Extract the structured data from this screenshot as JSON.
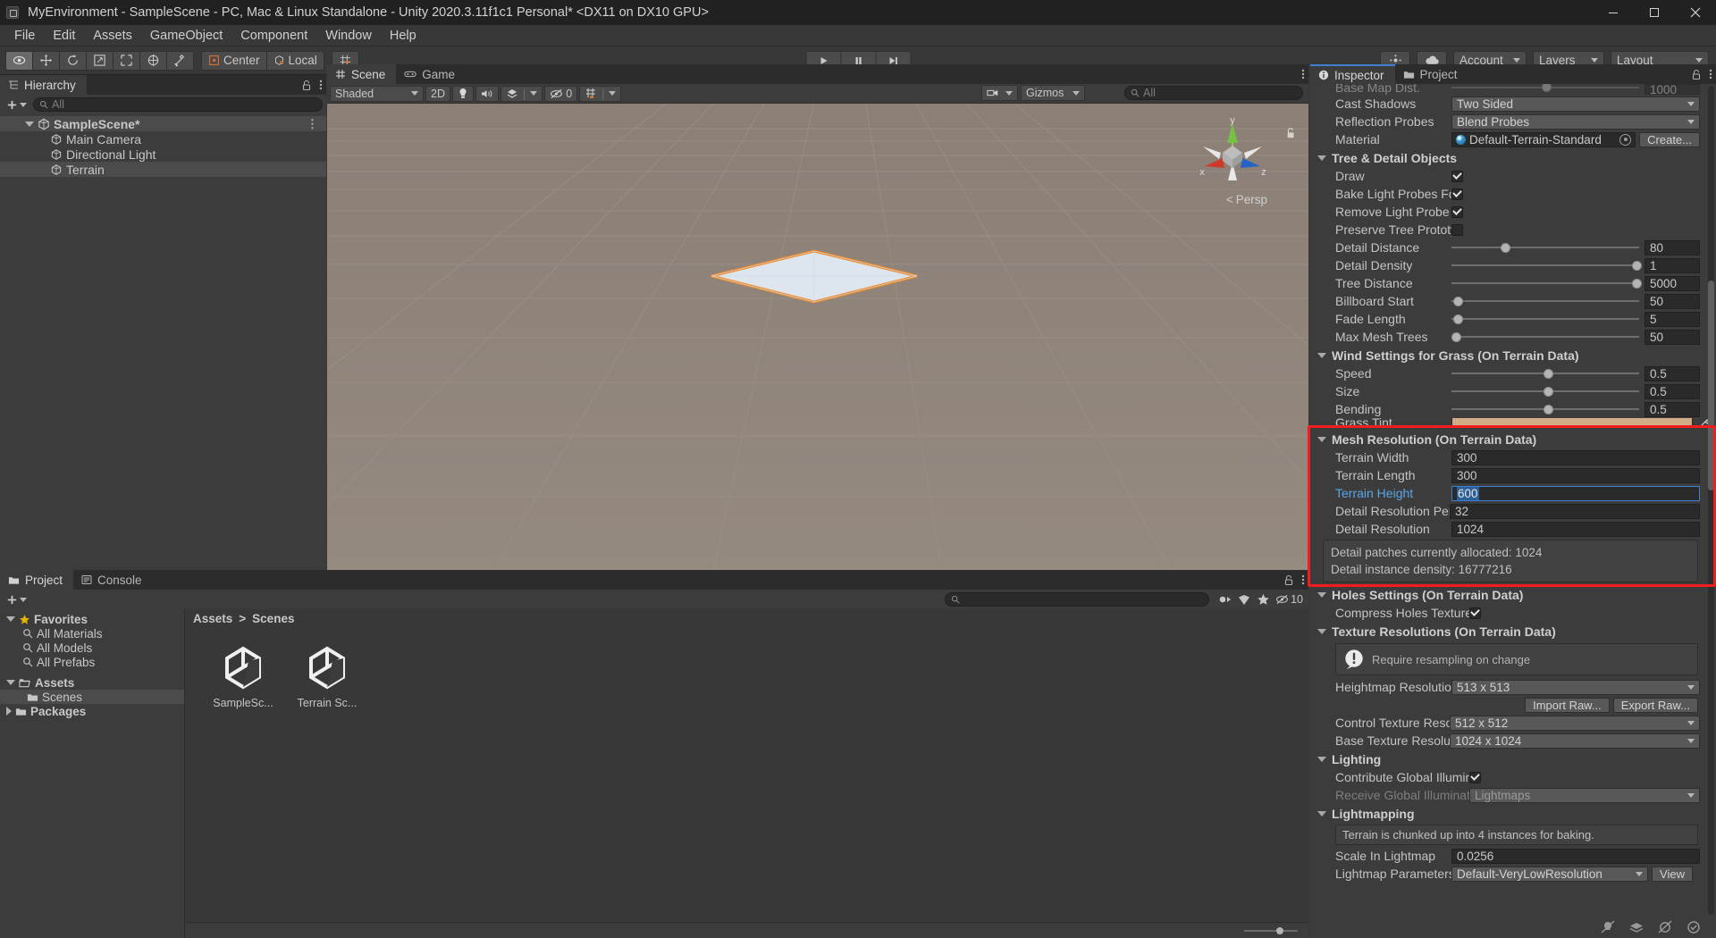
{
  "window": {
    "title": "MyEnvironment - SampleScene - PC, Mac & Linux Standalone - Unity 2020.3.11f1c1 Personal* <DX11 on DX10 GPU>",
    "minimize": "minimize-button",
    "maximize": "maximize-button",
    "close": "close-button"
  },
  "menu": [
    "File",
    "Edit",
    "Assets",
    "GameObject",
    "Component",
    "Window",
    "Help"
  ],
  "toolbar": {
    "tools": [
      "hand-tool",
      "move-tool",
      "rotate-tool",
      "scale-tool",
      "rect-tool",
      "transform-tool",
      "custom-tool"
    ],
    "pivot": "Center",
    "handle": "Local",
    "play": "play-button",
    "pause": "pause-button",
    "step": "step-button",
    "collab": "collab-icon",
    "cloud": "cloud-icon",
    "account": "Account",
    "layers": "Layers",
    "layout": "Layout"
  },
  "hierarchy": {
    "tab": "Hierarchy",
    "search_placeholder": "All",
    "create_label": "+",
    "items": [
      {
        "label": "SampleScene*",
        "depth": 0,
        "kind": "scene",
        "selected": false
      },
      {
        "label": "Main Camera",
        "depth": 1,
        "kind": "gameobject",
        "selected": false
      },
      {
        "label": "Directional Light",
        "depth": 1,
        "kind": "gameobject",
        "selected": false
      },
      {
        "label": "Terrain",
        "depth": 1,
        "kind": "gameobject",
        "selected": true
      }
    ]
  },
  "scene": {
    "tabs": [
      {
        "label": "Scene",
        "icon": "grid-icon",
        "selected": true
      },
      {
        "label": "Game",
        "icon": "gamepad-icon",
        "selected": false
      }
    ],
    "shading": "Shaded",
    "mode_2d": "2D",
    "lighting": "lighting-toggle-icon",
    "audio": "audio-toggle-icon",
    "fx": "effects-icon",
    "hidden_count": "0",
    "grid": "grid-visibility-icon",
    "gizmos": "Gizmos",
    "search_placeholder": "All",
    "persp_label": "Persp",
    "axis_x": "x",
    "axis_y": "y",
    "axis_z": "z"
  },
  "project": {
    "tabs": [
      {
        "label": "Project",
        "icon": "folder-icon",
        "selected": true
      },
      {
        "label": "Console",
        "icon": "console-icon",
        "selected": false
      }
    ],
    "search_placeholder": "",
    "tree": [
      {
        "label": "Favorites",
        "depth": 0,
        "kind": "star",
        "expanded": true,
        "bold": true
      },
      {
        "label": "All Materials",
        "depth": 1,
        "kind": "search",
        "bold": false
      },
      {
        "label": "All Models",
        "depth": 1,
        "kind": "search",
        "bold": false
      },
      {
        "label": "All Prefabs",
        "depth": 1,
        "kind": "search",
        "bold": false
      },
      {
        "label": "Assets",
        "depth": 0,
        "kind": "folder-open",
        "expanded": true,
        "bold": true
      },
      {
        "label": "Scenes",
        "depth": 1,
        "kind": "folder",
        "selected": true,
        "bold": false
      },
      {
        "label": "Packages",
        "depth": 0,
        "kind": "folder",
        "expanded": false,
        "bold": true
      }
    ],
    "breadcrumb": [
      "Assets",
      "Scenes"
    ],
    "assets": [
      {
        "name": "SampleSc...",
        "icon": "unity-scene-icon"
      },
      {
        "name": "Terrain Sc...",
        "icon": "unity-scene-icon"
      }
    ],
    "filter_icons": [
      "asset-filter-icon",
      "label-filter-icon",
      "favorite-filter-icon",
      "visibility-icon"
    ],
    "visibility_count": "10"
  },
  "inspector": {
    "tabs": [
      {
        "label": "Inspector",
        "icon": "info-icon",
        "selected": true
      },
      {
        "label": "Project",
        "icon": "folder-icon",
        "selected": false
      }
    ],
    "clipped_top_row": {
      "label": "Base Map Dist.",
      "value": "1000"
    },
    "rows_top": [
      {
        "label": "Cast Shadows",
        "type": "dropdown",
        "value": "Two Sided"
      },
      {
        "label": "Reflection Probes",
        "type": "dropdown",
        "value": "Blend Probes"
      },
      {
        "label": "Material",
        "type": "object",
        "value": "Default-Terrain-Standard",
        "button": "Create..."
      }
    ],
    "tree_detail": {
      "title": "Tree & Detail Objects",
      "rows": [
        {
          "label": "Draw",
          "type": "checkbox",
          "checked": true
        },
        {
          "label": "Bake Light Probes For Tree",
          "type": "checkbox",
          "checked": true
        },
        {
          "label": "Remove Light Probe Ringing",
          "type": "checkbox",
          "checked": true
        },
        {
          "label": "Preserve Tree Prototype L",
          "type": "checkbox",
          "checked": false
        },
        {
          "label": "Detail Distance",
          "type": "slider",
          "value": "80",
          "fill": 0.26
        },
        {
          "label": "Detail Density",
          "type": "slider",
          "value": "1",
          "fill": 0.97
        },
        {
          "label": "Tree Distance",
          "type": "slider",
          "value": "5000",
          "fill": 0.97
        },
        {
          "label": "Billboard Start",
          "type": "slider",
          "value": "50",
          "fill": 0.03
        },
        {
          "label": "Fade Length",
          "type": "slider",
          "value": "5",
          "fill": 0.03
        },
        {
          "label": "Max Mesh Trees",
          "type": "slider",
          "value": "50",
          "fill": 0.01
        }
      ]
    },
    "wind_settings": {
      "title": "Wind Settings for Grass (On Terrain Data)",
      "rows": [
        {
          "label": "Speed",
          "type": "slider",
          "value": "0.5",
          "fill": 0.5
        },
        {
          "label": "Size",
          "type": "slider",
          "value": "0.5",
          "fill": 0.5
        },
        {
          "label": "Bending",
          "type": "slider",
          "value": "0.5",
          "fill": 0.5
        },
        {
          "label": "Grass Tint",
          "type": "color",
          "value": "#d2ab87"
        }
      ]
    },
    "mesh_resolution": {
      "title": "Mesh Resolution (On Terrain Data)",
      "highlighted": true,
      "highlight_color": "#f41c1c",
      "rows": [
        {
          "label": "Terrain Width",
          "type": "text",
          "value": "300"
        },
        {
          "label": "Terrain Length",
          "type": "text",
          "value": "300"
        },
        {
          "label": "Terrain Height",
          "type": "text",
          "value": "600",
          "focused": true,
          "selected_text": true
        },
        {
          "label": "Detail Resolution Per Patch",
          "type": "text",
          "value": "32"
        },
        {
          "label": "Detail Resolution",
          "type": "text",
          "value": "1024"
        }
      ],
      "info": [
        "Detail patches currently allocated: 1024",
        "Detail instance density: 16777216"
      ]
    },
    "holes_settings": {
      "title": "Holes Settings (On Terrain Data)",
      "rows": [
        {
          "label": "Compress Holes Texture",
          "type": "checkbox",
          "checked": true
        }
      ]
    },
    "texture_resolutions": {
      "title": "Texture Resolutions (On Terrain Data)",
      "warning": "Require resampling on change",
      "rows": [
        {
          "label": "Heightmap Resolution",
          "type": "dropdown",
          "value": "513 x 513"
        },
        {
          "label": "Control Texture Resolution",
          "type": "dropdown",
          "value": "512 x 512"
        },
        {
          "label": "Base Texture Resolution",
          "type": "dropdown",
          "value": "1024 x 1024"
        }
      ],
      "buttons": [
        "Import Raw...",
        "Export Raw..."
      ]
    },
    "lighting": {
      "title": "Lighting",
      "rows": [
        {
          "label": "Contribute Global Illumination",
          "type": "checkbox",
          "checked": true
        },
        {
          "label": "Receive Global Illumination",
          "type": "dropdown",
          "value": "Lightmaps",
          "disabled": true
        }
      ]
    },
    "lightmapping": {
      "title": "Lightmapping",
      "info": "Terrain is chunked up into 4 instances for baking.",
      "rows": [
        {
          "label": "Scale In Lightmap",
          "type": "text",
          "value": "0.0256"
        },
        {
          "label": "Lightmap Parameters",
          "type": "dropdown",
          "value": "Default-VeryLowResolution",
          "button": "View"
        }
      ]
    },
    "footer_icons": [
      "no-light-icon",
      "lightmap-icon",
      "no-shadow-icon",
      "check-icon"
    ]
  }
}
